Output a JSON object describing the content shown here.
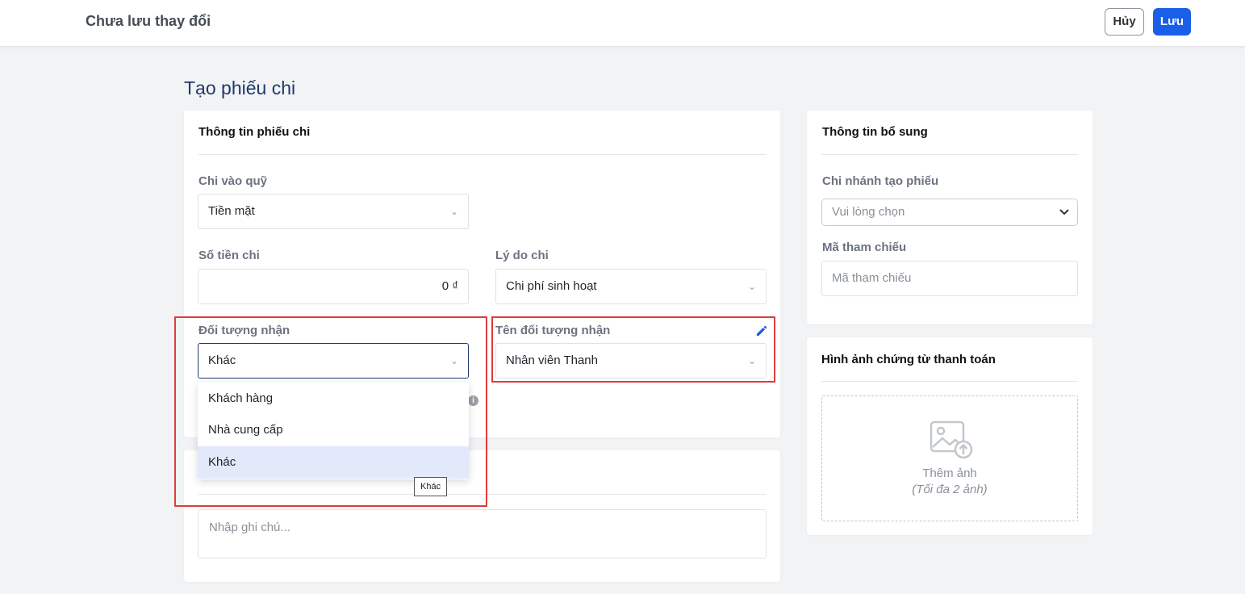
{
  "header": {
    "status": "Chưa lưu thay đổi",
    "cancel_label": "Hủy",
    "save_label": "Lưu"
  },
  "page": {
    "title": "Tạo phiếu chi"
  },
  "voucher_info": {
    "title": "Thông tin phiếu chi",
    "fund_label": "Chi vào quỹ",
    "fund_value": "Tiền mặt",
    "amount_label": "Số tiền chi",
    "amount_value": "0 ₫",
    "reason_label": "Lý do chi",
    "reason_value": "Chi phí sinh hoạt",
    "recipient_type_label": "Đối tượng nhận",
    "recipient_type_value": "Khác",
    "recipient_name_label": "Tên đối tượng nhận",
    "recipient_name_value": "Nhân viên Thanh"
  },
  "recipient_dropdown": {
    "options": [
      "Khách hàng",
      "Nhà cung cấp",
      "Khác"
    ],
    "selected": "Khác",
    "tooltip": "Khác"
  },
  "note": {
    "placeholder": "Nhập ghi chú..."
  },
  "extra_info": {
    "title": "Thông tin bổ sung",
    "branch_label": "Chi nhánh tạo phiếu",
    "branch_placeholder": "Vui lòng chọn",
    "ref_label": "Mã tham chiếu",
    "ref_placeholder": "Mã tham chiếu"
  },
  "attachments": {
    "title": "Hình ảnh chứng từ thanh toán",
    "add_label": "Thêm ảnh",
    "add_hint": "(Tối đa 2 ảnh)"
  },
  "icons": {
    "chevron": "chevron-down-icon",
    "edit": "pencil-icon",
    "info": "info-icon",
    "upload": "image-upload-icon"
  },
  "colors": {
    "primary": "#1a5fe8",
    "title": "#1e3a6a",
    "highlight_box": "#e03c3c",
    "selected_option": "#e1e9fb"
  }
}
